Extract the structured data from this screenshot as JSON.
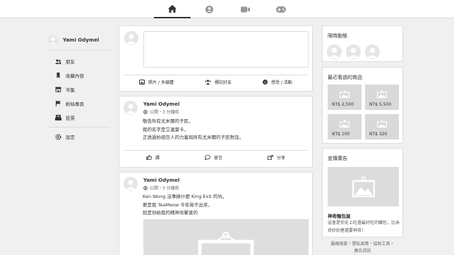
{
  "nav": {
    "tabs": [
      {
        "name": "home",
        "icon": "home-icon",
        "active": true
      },
      {
        "name": "profile",
        "icon": "user-circle-icon",
        "active": false
      },
      {
        "name": "video",
        "icon": "video-icon",
        "active": false
      },
      {
        "name": "gaming",
        "icon": "gamepad-icon",
        "active": false
      }
    ]
  },
  "user": {
    "name": "Yami Odymel"
  },
  "sidebar": {
    "items": [
      {
        "label": "朋友",
        "icon": "friends-icon"
      },
      {
        "label": "收藏內容",
        "icon": "bookmark-icon"
      },
      {
        "label": "市集",
        "icon": "store-icon"
      },
      {
        "label": "粉絲專頁",
        "icon": "flag-icon"
      },
      {
        "label": "投票",
        "icon": "poll-icon"
      }
    ],
    "settings_label": "設定"
  },
  "composer": {
    "photo_label": "照片 / 多媒體",
    "tag_label": "標記好友",
    "feeling_label": "感受 / 活動"
  },
  "posts": [
    {
      "author": "Yami Odymel",
      "time": "公開・3 分鐘前",
      "lines": [
        "敬告所有尤米爾的子民，",
        "我的名字是艾連葉卡，",
        "正透過始祖巨人的力量與所有尤米爾的子民對話。"
      ],
      "actions": {
        "like": "讚",
        "comment": "留言",
        "share": "分享"
      }
    },
    {
      "author": "Yami Odymel",
      "time": "公開・3 分鐘前",
      "lines": [
        "Ken Wong 沒事捲什麼 King Exit 的坑，",
        "要是我 TeaMeow 今年寫不出來，",
        "就是你給我的精神攻擊害的"
      ]
    }
  ],
  "right": {
    "stories_title": "限時動態",
    "products_title": "最近看過的商品",
    "products": [
      {
        "price": "NT$ 2,500"
      },
      {
        "price": "NT$ 5,500"
      },
      {
        "price": "NT$ 100"
      },
      {
        "price": "NT$ 320"
      }
    ],
    "ad_title": "宣傳廣告",
    "ad_name": "神奇麵包屋",
    "ad_desc": "這會是你史上吃過最好吃的麵包，比米奇妙妙屋還要神奇！"
  },
  "footer": {
    "line1": "服務條款・隱私政策・協助工具・",
    "line2": "廣告資訊"
  },
  "colors": {
    "background": "#f0f0f0",
    "card": "#ffffff",
    "border": "#dddddd",
    "text": "#333333"
  }
}
